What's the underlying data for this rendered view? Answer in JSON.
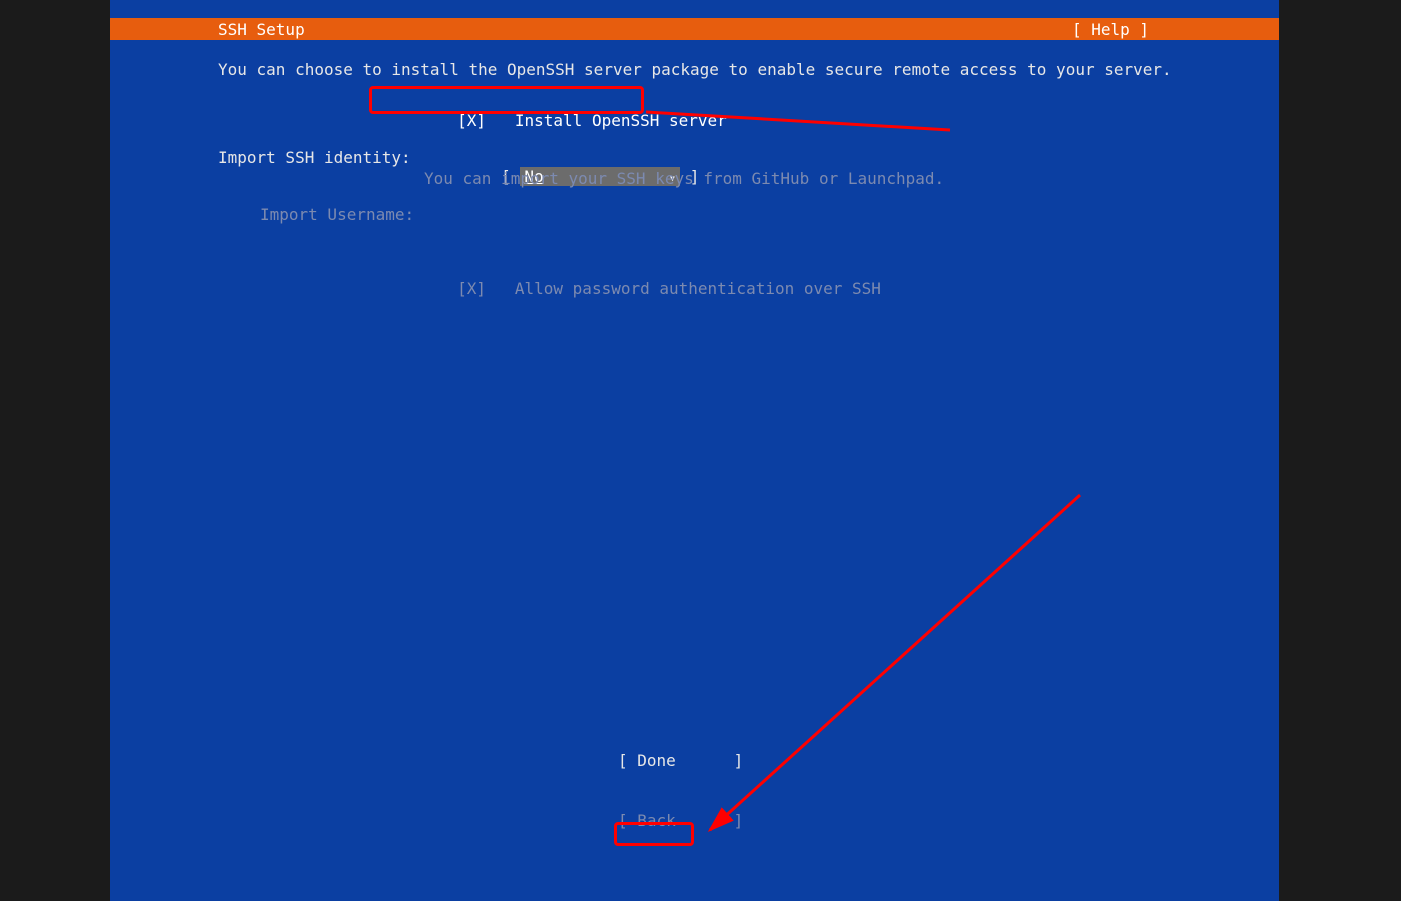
{
  "header": {
    "title": "SSH Setup",
    "help_label": "[ Help ]"
  },
  "intro": "You can choose to install the OpenSSH server package to enable secure remote access to your server.",
  "install_checkbox": {
    "marker": "[X]",
    "label": "Install OpenSSH server"
  },
  "identity": {
    "label": "Import SSH identity:",
    "open_bracket": "[ ",
    "value": "No",
    "arrow": "▾",
    "close_bracket": " ]",
    "hint": "You can import your SSH keys from GitHub or Launchpad."
  },
  "username": {
    "label": "Import Username:"
  },
  "allow_password": {
    "marker": "[X]",
    "label": "Allow password authentication over SSH"
  },
  "footer": {
    "done_open": "[ ",
    "done_label": "Done",
    "done_pad": "      ",
    "done_close": "]",
    "back_open": "[ ",
    "back_label": "Back",
    "back_pad": "      ",
    "back_close": "]"
  }
}
